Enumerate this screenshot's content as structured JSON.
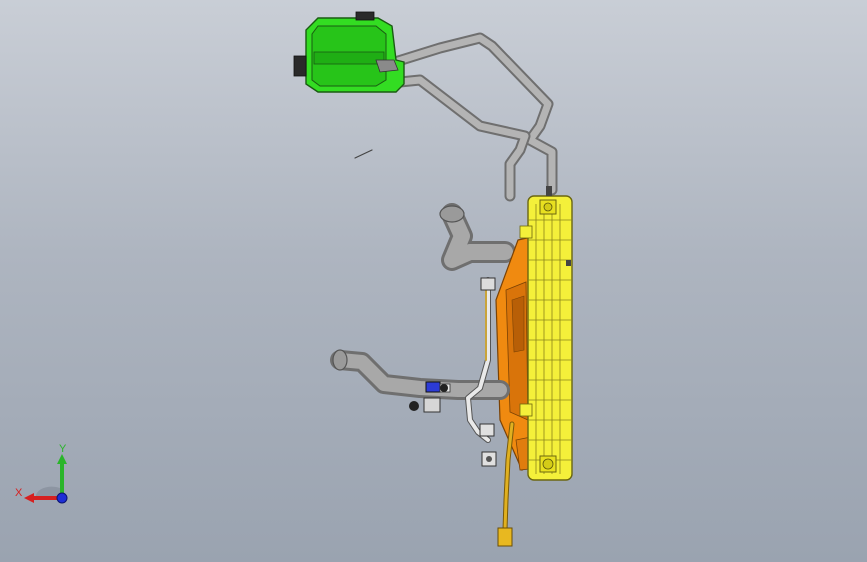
{
  "axes": {
    "x_label": "X",
    "y_label": "Y"
  },
  "colors": {
    "background_top": "#c9ced6",
    "background_bottom": "#9aa3b0",
    "tank": "#33dd22",
    "pipe": "#9a9a9a",
    "radiator": "#f4f03a",
    "fan_shroud": "#f08a10",
    "axis_x": "#d62020",
    "axis_y": "#2ab52a",
    "axis_z": "#1e2ed6"
  },
  "components": [
    "expansion-tank",
    "coolant-hose",
    "radiator",
    "fan-shroud",
    "intake-pipe",
    "outlet-pipe",
    "drain-tube"
  ]
}
